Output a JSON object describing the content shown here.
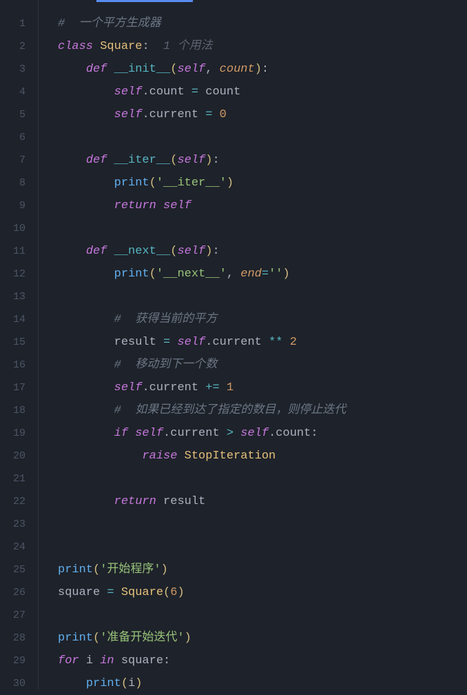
{
  "lines": [
    {
      "n": 1,
      "html": "<span class='comment'>#  一个平方生成器</span>"
    },
    {
      "n": 2,
      "html": "<span class='keyword'>class</span> <span class='classname'>Square</span><span class='punct'>:</span>  <span class='hint'>1 个用法</span>"
    },
    {
      "n": 3,
      "html": "    <span class='def'>def</span> <span class='dunder'>__init__</span><span class='paren'>(</span><span class='self'>self</span><span class='punct'>,</span> <span class='param'>count</span><span class='paren'>)</span><span class='punct'>:</span>"
    },
    {
      "n": 4,
      "html": "        <span class='self'>self</span><span class='punct'>.</span><span class='prop'>count</span> <span class='op'>=</span> <span class='prop'>count</span>"
    },
    {
      "n": 5,
      "html": "        <span class='self'>self</span><span class='punct'>.</span><span class='prop'>current</span> <span class='op'>=</span> <span class='number'>0</span>"
    },
    {
      "n": 6,
      "html": ""
    },
    {
      "n": 7,
      "html": "    <span class='def'>def</span> <span class='dunder'>__iter__</span><span class='paren'>(</span><span class='self'>self</span><span class='paren'>)</span><span class='punct'>:</span>"
    },
    {
      "n": 8,
      "html": "        <span class='builtin'>print</span><span class='paren'>(</span><span class='string'>'__iter__'</span><span class='paren'>)</span>"
    },
    {
      "n": 9,
      "html": "        <span class='ret'>return</span> <span class='self'>self</span>"
    },
    {
      "n": 10,
      "html": ""
    },
    {
      "n": 11,
      "html": "    <span class='def'>def</span> <span class='dunder'>__next__</span><span class='paren'>(</span><span class='self'>self</span><span class='paren'>)</span><span class='punct'>:</span>"
    },
    {
      "n": 12,
      "html": "        <span class='builtin'>print</span><span class='paren'>(</span><span class='string'>'__next__'</span><span class='punct'>,</span> <span class='param'>end</span><span class='op'>=</span><span class='string'>''</span><span class='paren'>)</span>"
    },
    {
      "n": 13,
      "html": ""
    },
    {
      "n": 14,
      "html": "        <span class='comment'>#  获得当前的平方</span>"
    },
    {
      "n": 15,
      "html": "        <span class='prop'>result</span> <span class='op'>=</span> <span class='self'>self</span><span class='punct'>.</span><span class='prop'>current</span> <span class='op'>**</span> <span class='number'>2</span>"
    },
    {
      "n": 16,
      "html": "        <span class='comment'>#  移动到下一个数</span>"
    },
    {
      "n": 17,
      "html": "        <span class='self'>self</span><span class='punct'>.</span><span class='prop'>current</span> <span class='op'>+=</span> <span class='number'>1</span>"
    },
    {
      "n": 18,
      "html": "        <span class='comment'>#  如果已经到达了指定的数目，则停止迭代</span>"
    },
    {
      "n": 19,
      "html": "        <span class='keyword'>if</span> <span class='self'>self</span><span class='punct'>.</span><span class='prop'>current</span> <span class='op'>&gt;</span> <span class='self'>self</span><span class='punct'>.</span><span class='prop'>count</span><span class='punct'>:</span>"
    },
    {
      "n": 20,
      "html": "            <span class='keyword'>raise</span> <span class='classname'>StopIteration</span>"
    },
    {
      "n": 21,
      "html": ""
    },
    {
      "n": 22,
      "html": "        <span class='ret'>return</span> <span class='prop'>result</span>"
    },
    {
      "n": 23,
      "html": ""
    },
    {
      "n": 24,
      "html": ""
    },
    {
      "n": 25,
      "html": "<span class='builtin'>print</span><span class='paren'>(</span><span class='string'>'开始程序'</span><span class='paren'>)</span>"
    },
    {
      "n": 26,
      "html": "<span class='prop'>square</span> <span class='op'>=</span> <span class='classname'>Square</span><span class='paren'>(</span><span class='number'>6</span><span class='paren'>)</span>"
    },
    {
      "n": 27,
      "html": ""
    },
    {
      "n": 28,
      "html": "<span class='builtin'>print</span><span class='paren'>(</span><span class='string'>'准备开始迭代'</span><span class='paren'>)</span>"
    },
    {
      "n": 29,
      "html": "<span class='keyword'>for</span> <span class='prop'>i</span> <span class='keyword'>in</span> <span class='prop'>square</span><span class='punct'>:</span>"
    },
    {
      "n": 30,
      "html": "    <span class='builtin'>print</span><span class='paren'>(</span><span class='prop'>i</span><span class='paren'>)</span>"
    }
  ]
}
